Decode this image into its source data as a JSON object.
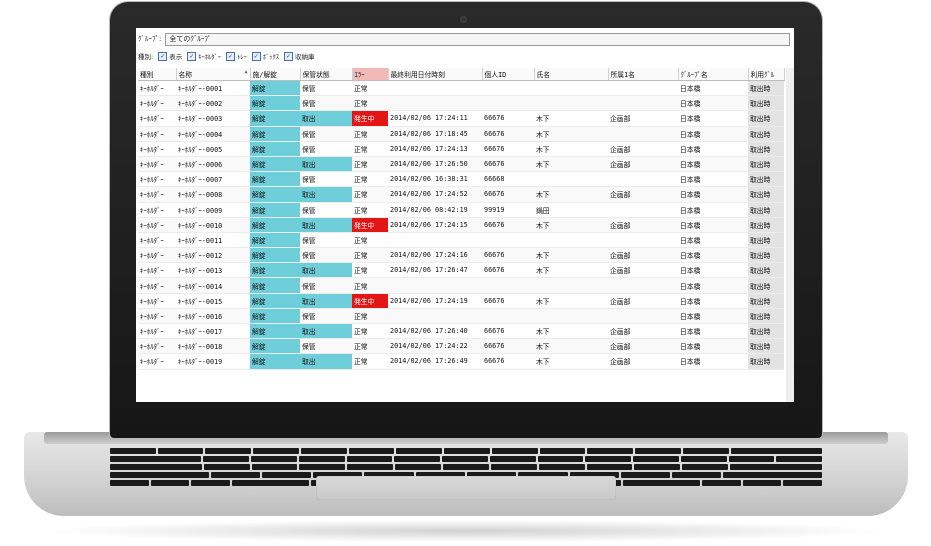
{
  "filter": {
    "label": "ｸﾞﾙｰﾌﾟ:",
    "value": "全てのｸﾞﾙｰﾌﾟ"
  },
  "types": {
    "label": "種別:",
    "options": [
      {
        "label": "表示",
        "checked": true
      },
      {
        "label": "ｷｰﾎﾙﾀﾞｰ",
        "checked": true
      },
      {
        "label": "ﾄﾚｰ",
        "checked": true
      },
      {
        "label": "ﾎﾞｯｸｽ",
        "checked": true
      },
      {
        "label": "収納庫",
        "checked": true
      }
    ]
  },
  "columns": [
    "種別",
    "名称",
    "施/解錠",
    "保管状態",
    "ｴﾗｰ",
    "最終利用日付時刻",
    "個人ID",
    "氏名",
    "所属1名",
    "ｸﾞﾙｰﾌﾟ名",
    "利用ｸﾞﾙ"
  ],
  "sort_arrow": "▲",
  "rows": [
    {
      "type": "ｷｰﾎﾙﾀﾞｰ",
      "name": "ｷｰﾎﾙﾀﾞｰ-0001",
      "lock": "解錠",
      "storage": "保管",
      "error": "正常",
      "time": "",
      "pid": "",
      "person": "",
      "dept": "",
      "group": "日本橋",
      "use": "取出時"
    },
    {
      "type": "ｷｰﾎﾙﾀﾞｰ",
      "name": "ｷｰﾎﾙﾀﾞｰ-0002",
      "lock": "解錠",
      "storage": "保管",
      "error": "正常",
      "time": "",
      "pid": "",
      "person": "",
      "dept": "",
      "group": "日本橋",
      "use": "取出時"
    },
    {
      "type": "ｷｰﾎﾙﾀﾞｰ",
      "name": "ｷｰﾎﾙﾀﾞｰ-0003",
      "lock": "解錠",
      "storage": "取出",
      "error": "発生中",
      "time": "2014/02/06 17:24:11",
      "pid": "66676",
      "person": "木下",
      "dept": "企画部",
      "group": "日本橋",
      "use": "取出時"
    },
    {
      "type": "ｷｰﾎﾙﾀﾞｰ",
      "name": "ｷｰﾎﾙﾀﾞｰ-0004",
      "lock": "解錠",
      "storage": "保管",
      "error": "正常",
      "time": "2014/02/06 17:18:45",
      "pid": "66676",
      "person": "木下",
      "dept": "",
      "group": "日本橋",
      "use": "取出時"
    },
    {
      "type": "ｷｰﾎﾙﾀﾞｰ",
      "name": "ｷｰﾎﾙﾀﾞｰ-0005",
      "lock": "解錠",
      "storage": "保管",
      "error": "正常",
      "time": "2014/02/06 17:24:13",
      "pid": "66676",
      "person": "木下",
      "dept": "企画部",
      "group": "日本橋",
      "use": "取出時"
    },
    {
      "type": "ｷｰﾎﾙﾀﾞｰ",
      "name": "ｷｰﾎﾙﾀﾞｰ-0006",
      "lock": "解錠",
      "storage": "取出",
      "error": "正常",
      "time": "2014/02/06 17:26:50",
      "pid": "66676",
      "person": "木下",
      "dept": "企画部",
      "group": "日本橋",
      "use": "取出時"
    },
    {
      "type": "ｷｰﾎﾙﾀﾞｰ",
      "name": "ｷｰﾎﾙﾀﾞｰ-0007",
      "lock": "解錠",
      "storage": "保管",
      "error": "正常",
      "time": "2014/02/06 16:38:31",
      "pid": "66668",
      "person": "",
      "dept": "",
      "group": "日本橋",
      "use": "取出時"
    },
    {
      "type": "ｷｰﾎﾙﾀﾞｰ",
      "name": "ｷｰﾎﾙﾀﾞｰ-0008",
      "lock": "解錠",
      "storage": "取出",
      "error": "正常",
      "time": "2014/02/06 17:24:52",
      "pid": "66676",
      "person": "木下",
      "dept": "企画部",
      "group": "日本橋",
      "use": "取出時"
    },
    {
      "type": "ｷｰﾎﾙﾀﾞｰ",
      "name": "ｷｰﾎﾙﾀﾞｰ-0009",
      "lock": "解錠",
      "storage": "保管",
      "error": "正常",
      "time": "2014/02/06 08:42:19",
      "pid": "99919",
      "person": "鍋田",
      "dept": "",
      "group": "日本橋",
      "use": "取出時"
    },
    {
      "type": "ｷｰﾎﾙﾀﾞｰ",
      "name": "ｷｰﾎﾙﾀﾞｰ-0010",
      "lock": "解錠",
      "storage": "取出",
      "error": "発生中",
      "time": "2014/02/06 17:24:15",
      "pid": "66676",
      "person": "木下",
      "dept": "企画部",
      "group": "日本橋",
      "use": "取出時"
    },
    {
      "type": "ｷｰﾎﾙﾀﾞｰ",
      "name": "ｷｰﾎﾙﾀﾞｰ-0011",
      "lock": "解錠",
      "storage": "保管",
      "error": "正常",
      "time": "",
      "pid": "",
      "person": "",
      "dept": "",
      "group": "日本橋",
      "use": "取出時"
    },
    {
      "type": "ｷｰﾎﾙﾀﾞｰ",
      "name": "ｷｰﾎﾙﾀﾞｰ-0012",
      "lock": "解錠",
      "storage": "保管",
      "error": "正常",
      "time": "2014/02/06 17:24:16",
      "pid": "66676",
      "person": "木下",
      "dept": "企画部",
      "group": "日本橋",
      "use": "取出時"
    },
    {
      "type": "ｷｰﾎﾙﾀﾞｰ",
      "name": "ｷｰﾎﾙﾀﾞｰ-0013",
      "lock": "解錠",
      "storage": "取出",
      "error": "正常",
      "time": "2014/02/06 17:26:47",
      "pid": "66676",
      "person": "木下",
      "dept": "企画部",
      "group": "日本橋",
      "use": "取出時"
    },
    {
      "type": "ｷｰﾎﾙﾀﾞｰ",
      "name": "ｷｰﾎﾙﾀﾞｰ-0014",
      "lock": "解錠",
      "storage": "保管",
      "error": "正常",
      "time": "",
      "pid": "",
      "person": "",
      "dept": "",
      "group": "日本橋",
      "use": "取出時"
    },
    {
      "type": "ｷｰﾎﾙﾀﾞｰ",
      "name": "ｷｰﾎﾙﾀﾞｰ-0015",
      "lock": "解錠",
      "storage": "取出",
      "error": "発生中",
      "time": "2014/02/06 17:24:19",
      "pid": "66676",
      "person": "木下",
      "dept": "企画部",
      "group": "日本橋",
      "use": "取出時"
    },
    {
      "type": "ｷｰﾎﾙﾀﾞｰ",
      "name": "ｷｰﾎﾙﾀﾞｰ-0016",
      "lock": "解錠",
      "storage": "保管",
      "error": "正常",
      "time": "",
      "pid": "",
      "person": "",
      "dept": "",
      "group": "日本橋",
      "use": "取出時"
    },
    {
      "type": "ｷｰﾎﾙﾀﾞｰ",
      "name": "ｷｰﾎﾙﾀﾞｰ-0017",
      "lock": "解錠",
      "storage": "取出",
      "error": "正常",
      "time": "2014/02/06 17:26:40",
      "pid": "66676",
      "person": "木下",
      "dept": "企画部",
      "group": "日本橋",
      "use": "取出時"
    },
    {
      "type": "ｷｰﾎﾙﾀﾞｰ",
      "name": "ｷｰﾎﾙﾀﾞｰ-0018",
      "lock": "解錠",
      "storage": "保管",
      "error": "正常",
      "time": "2014/02/06 17:24:22",
      "pid": "66676",
      "person": "木下",
      "dept": "企画部",
      "group": "日本橋",
      "use": "取出時"
    },
    {
      "type": "ｷｰﾎﾙﾀﾞｰ",
      "name": "ｷｰﾎﾙﾀﾞｰ-0019",
      "lock": "解錠",
      "storage": "取出",
      "error": "正常",
      "time": "2014/02/06 17:26:49",
      "pid": "66676",
      "person": "木下",
      "dept": "企画部",
      "group": "日本橋",
      "use": "取出時"
    }
  ],
  "colors": {
    "teal": "#6ecfdb",
    "error_red": "#e31616",
    "error_header": "#f2b9b9"
  }
}
